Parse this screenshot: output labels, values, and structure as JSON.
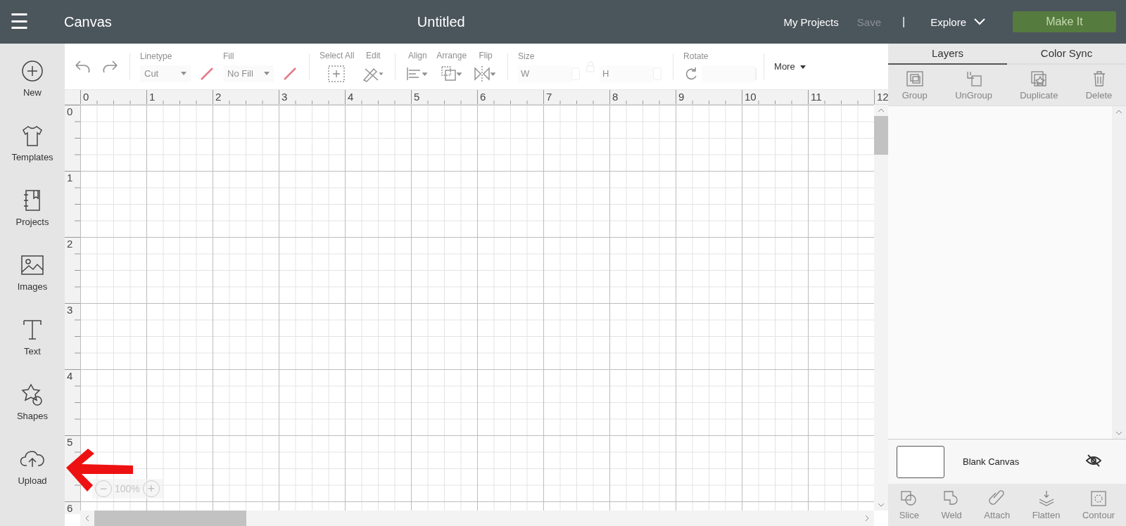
{
  "header": {
    "menu_icon": "☰",
    "app_title": "Canvas",
    "document_title": "Untitled",
    "links": [
      {
        "label": "My Projects",
        "disabled": false
      },
      {
        "label": "Save",
        "disabled": true
      }
    ],
    "separator": "|",
    "explore": "Explore",
    "make_it": {
      "label": "Make It",
      "disabled": true
    }
  },
  "sidebar": [
    {
      "label": "New",
      "kind": "new"
    },
    {
      "label": "Templates",
      "kind": "templates"
    },
    {
      "label": "Projects",
      "kind": "projects"
    },
    {
      "label": "Images",
      "kind": "images"
    },
    {
      "label": "Text",
      "kind": "text"
    },
    {
      "label": "Shapes",
      "kind": "shapes"
    },
    {
      "label": "Upload",
      "kind": "upload"
    }
  ],
  "toolbar": [
    [
      {
        "kind": "undo",
        "disabled": true
      },
      {
        "kind": "redo",
        "disabled": true
      }
    ],
    [
      {
        "kind": "select",
        "label": "Linetype",
        "value": "Cut",
        "disabled": true
      },
      {
        "kind": "swatch"
      },
      {
        "kind": "select",
        "label": "Fill",
        "value": "No Fill",
        "disabled": true
      },
      {
        "kind": "swatch"
      }
    ],
    [
      {
        "kind": "select_all",
        "label": "Select All",
        "disabled": true
      },
      {
        "kind": "edit",
        "label": "Edit",
        "disabled": true
      }
    ],
    [
      {
        "kind": "align",
        "label": "Align",
        "disabled": true
      },
      {
        "kind": "arrange",
        "label": "Arrange",
        "disabled": true
      },
      {
        "kind": "flip",
        "label": "Flip",
        "disabled": true
      }
    ],
    [
      {
        "kind": "size",
        "label": "Size",
        "fields": [
          {
            "placeholder": "W"
          },
          {
            "placeholder": "H"
          }
        ],
        "disabled": true
      }
    ],
    [
      {
        "kind": "rotate",
        "label": "Rotate",
        "disabled": true
      }
    ],
    [
      {
        "kind": "more",
        "label": "More"
      }
    ]
  ],
  "canvas": {
    "top_ruler": [
      "0",
      "1",
      "2",
      "3",
      "4",
      "5",
      "6",
      "7",
      "8",
      "9",
      "10",
      "11",
      "12"
    ],
    "left_ruler": [
      "0",
      "1",
      "2",
      "3",
      "4",
      "5",
      "6"
    ],
    "zoom": {
      "minus": "−",
      "level_text": "100%",
      "plus": "+"
    }
  },
  "panel": {
    "tabs": [
      {
        "label": "Layers",
        "selected": true
      },
      {
        "label": "Color Sync",
        "selected": false
      }
    ],
    "actions": [
      {
        "kind": "group",
        "label": "Group",
        "disabled": true
      },
      {
        "kind": "ungroup",
        "label": "UnGroup",
        "disabled": true
      },
      {
        "kind": "duplicate",
        "label": "Duplicate",
        "disabled": true
      },
      {
        "kind": "delete",
        "label": "Delete",
        "disabled": true
      }
    ],
    "layer": {
      "name": "Blank Canvas",
      "visible": false
    },
    "bottom_actions": [
      {
        "kind": "slice",
        "label": "Slice",
        "disabled": true
      },
      {
        "kind": "weld",
        "label": "Weld",
        "disabled": true
      },
      {
        "kind": "attach",
        "label": "Attach",
        "disabled": true
      },
      {
        "kind": "flatten",
        "label": "Flatten",
        "disabled": true
      },
      {
        "kind": "contour",
        "label": "Contour",
        "disabled": true
      }
    ]
  }
}
